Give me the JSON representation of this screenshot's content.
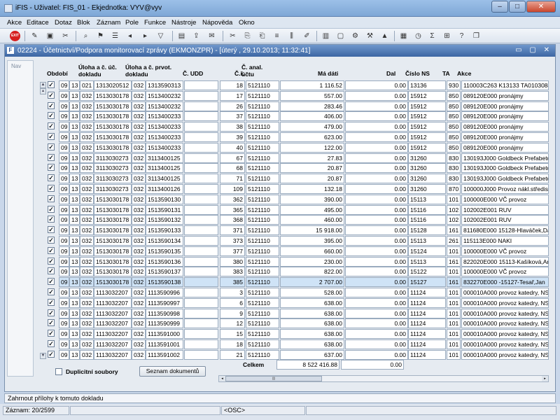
{
  "app": {
    "title": "iFIS - Uživatel: FIS_01 - Ekjednotka: VYV@vyv"
  },
  "window_buttons": {
    "minimize": "–",
    "maximize": "□",
    "close": "✕"
  },
  "menu": [
    {
      "label": "Akce"
    },
    {
      "label": "Editace"
    },
    {
      "label": "Dotaz"
    },
    {
      "label": "Blok"
    },
    {
      "label": "Záznam"
    },
    {
      "label": "Pole"
    },
    {
      "label": "Funkce"
    },
    {
      "label": "Nástroje"
    },
    {
      "label": "Nápověda"
    },
    {
      "label": "Okno"
    }
  ],
  "toolbar": {
    "exit_label": "EXIT"
  },
  "form": {
    "title": "02224 - Účetnictví/Podpora monitorovací zprávy (EKMONZPR) - [úterý , 29.10.2013; 11:32:41]",
    "window_buttons": "▭ ▢ ✕",
    "nav_label": "Nav"
  },
  "columns": {
    "obdobi": "Období",
    "uloha_dokladu": "Úloha a č. úč. dokladu",
    "uloha_prvot": "Úloha a č. prvot. dokladu",
    "c_udd": "Č. UDD",
    "c_r": "Č.ř.",
    "c_anal": "Č. anal. účtu",
    "ma_dati": "Má dáti",
    "dal": "Dal",
    "cislo_ns": "Číslo NS",
    "ta": "TA",
    "akce": "Akce"
  },
  "rows": [
    {
      "checked": true,
      "m": "09",
      "y": "13",
      "u1": "021",
      "d1": "1313020512",
      "u2": "032",
      "d2": "1313590313",
      "udd": "",
      "cr": "18",
      "anal": "5121110",
      "md": "1 116.52",
      "dal": "0.00",
      "ns": "13136",
      "ta": "930",
      "akce": "110003C263 K13133 TA01030847",
      "selected": false
    },
    {
      "checked": true,
      "m": "09",
      "y": "13",
      "u1": "032",
      "d1": "1513030178",
      "u2": "032",
      "d2": "1513400232",
      "udd": "",
      "cr": "17",
      "anal": "5121110",
      "md": "557.00",
      "dal": "0.00",
      "ns": "15912",
      "ta": "850",
      "akce": "089120E000 pronájmy",
      "selected": false
    },
    {
      "checked": true,
      "m": "09",
      "y": "13",
      "u1": "032",
      "d1": "1513030178",
      "u2": "032",
      "d2": "1513400232",
      "udd": "",
      "cr": "26",
      "anal": "5121110",
      "md": "283.46",
      "dal": "0.00",
      "ns": "15912",
      "ta": "850",
      "akce": "089120E000 pronájmy",
      "selected": false
    },
    {
      "checked": true,
      "m": "09",
      "y": "13",
      "u1": "032",
      "d1": "1513030178",
      "u2": "032",
      "d2": "1513400233",
      "udd": "",
      "cr": "37",
      "anal": "5121110",
      "md": "406.00",
      "dal": "0.00",
      "ns": "15912",
      "ta": "850",
      "akce": "089120E000 pronájmy",
      "selected": false
    },
    {
      "checked": true,
      "m": "09",
      "y": "13",
      "u1": "032",
      "d1": "1513030178",
      "u2": "032",
      "d2": "1513400233",
      "udd": "",
      "cr": "38",
      "anal": "5121110",
      "md": "479.00",
      "dal": "0.00",
      "ns": "15912",
      "ta": "850",
      "akce": "089120E000 pronájmy",
      "selected": false
    },
    {
      "checked": true,
      "m": "09",
      "y": "13",
      "u1": "032",
      "d1": "1513030178",
      "u2": "032",
      "d2": "1513400233",
      "udd": "",
      "cr": "39",
      "anal": "5121110",
      "md": "623.00",
      "dal": "0.00",
      "ns": "15912",
      "ta": "850",
      "akce": "089120E000 pronájmy",
      "selected": false
    },
    {
      "checked": true,
      "m": "09",
      "y": "13",
      "u1": "032",
      "d1": "1513030178",
      "u2": "032",
      "d2": "1513400233",
      "udd": "",
      "cr": "40",
      "anal": "5121110",
      "md": "122.00",
      "dal": "0.00",
      "ns": "15912",
      "ta": "850",
      "akce": "089120E000 pronájmy",
      "selected": false
    },
    {
      "checked": true,
      "m": "09",
      "y": "13",
      "u1": "032",
      "d1": "3113030273",
      "u2": "032",
      "d2": "3113400125",
      "udd": "",
      "cr": "67",
      "anal": "5121110",
      "md": "27.83",
      "dal": "0.00",
      "ns": "31260",
      "ta": "830",
      "akce": "130193J000 Goldbeck Prefabeton",
      "selected": false
    },
    {
      "checked": true,
      "m": "09",
      "y": "13",
      "u1": "032",
      "d1": "3113030273",
      "u2": "032",
      "d2": "3113400125",
      "udd": "",
      "cr": "68",
      "anal": "5121110",
      "md": "20.87",
      "dal": "0.00",
      "ns": "31260",
      "ta": "830",
      "akce": "130193J000 Goldbeck Prefabeton",
      "selected": false
    },
    {
      "checked": true,
      "m": "09",
      "y": "13",
      "u1": "032",
      "d1": "3113030273",
      "u2": "032",
      "d2": "3113400125",
      "udd": "",
      "cr": "71",
      "anal": "5121110",
      "md": "20.87",
      "dal": "0.00",
      "ns": "31260",
      "ta": "830",
      "akce": "130193J000 Goldbeck Prefabeton",
      "selected": false
    },
    {
      "checked": true,
      "m": "09",
      "y": "13",
      "u1": "032",
      "d1": "3113030273",
      "u2": "032",
      "d2": "3113400126",
      "udd": "",
      "cr": "109",
      "anal": "5121110",
      "md": "132.18",
      "dal": "0.00",
      "ns": "31260",
      "ta": "870",
      "akce": "100000J000 Provoz nákl.střediska",
      "selected": false
    },
    {
      "checked": true,
      "m": "09",
      "y": "13",
      "u1": "032",
      "d1": "1513030178",
      "u2": "032",
      "d2": "1513590130",
      "udd": "",
      "cr": "362",
      "anal": "5121110",
      "md": "390.00",
      "dal": "0.00",
      "ns": "15113",
      "ta": "101",
      "akce": "100000E000 VČ provoz",
      "selected": false
    },
    {
      "checked": true,
      "m": "09",
      "y": "13",
      "u1": "032",
      "d1": "1513030178",
      "u2": "032",
      "d2": "1513590131",
      "udd": "",
      "cr": "365",
      "anal": "5121110",
      "md": "495.00",
      "dal": "0.00",
      "ns": "15116",
      "ta": "102",
      "akce": "102002E001 RUV",
      "selected": false
    },
    {
      "checked": true,
      "m": "09",
      "y": "13",
      "u1": "032",
      "d1": "1513030178",
      "u2": "032",
      "d2": "1513590132",
      "udd": "",
      "cr": "368",
      "anal": "5121110",
      "md": "460.00",
      "dal": "0.00",
      "ns": "15116",
      "ta": "102",
      "akce": "102002E001 RUV",
      "selected": false
    },
    {
      "checked": true,
      "m": "09",
      "y": "13",
      "u1": "032",
      "d1": "1513030178",
      "u2": "032",
      "d2": "1513590133",
      "udd": "",
      "cr": "371",
      "anal": "5121110",
      "md": "15 918.00",
      "dal": "0.00",
      "ns": "15128",
      "ta": "161",
      "akce": "811680E000 15128-Hlaváček,Dalibo",
      "selected": false
    },
    {
      "checked": true,
      "m": "09",
      "y": "13",
      "u1": "032",
      "d1": "1513030178",
      "u2": "032",
      "d2": "1513590134",
      "udd": "",
      "cr": "373",
      "anal": "5121110",
      "md": "395.00",
      "dal": "0.00",
      "ns": "15113",
      "ta": "261",
      "akce": "115113E000 NAKI",
      "selected": false
    },
    {
      "checked": true,
      "m": "09",
      "y": "13",
      "u1": "032",
      "d1": "1513030178",
      "u2": "032",
      "d2": "1513590135",
      "udd": "",
      "cr": "377",
      "anal": "5121110",
      "md": "660.00",
      "dal": "0.00",
      "ns": "15124",
      "ta": "101",
      "akce": "100000E000 VČ provoz",
      "selected": false
    },
    {
      "checked": true,
      "m": "09",
      "y": "13",
      "u1": "032",
      "d1": "1513030178",
      "u2": "032",
      "d2": "1513590136",
      "udd": "",
      "cr": "380",
      "anal": "5121110",
      "md": "230.00",
      "dal": "0.00",
      "ns": "15113",
      "ta": "161",
      "akce": "822020E000 15113-Kašíková,Anna",
      "selected": false
    },
    {
      "checked": true,
      "m": "09",
      "y": "13",
      "u1": "032",
      "d1": "1513030178",
      "u2": "032",
      "d2": "1513590137",
      "udd": "",
      "cr": "383",
      "anal": "5121110",
      "md": "822.00",
      "dal": "0.00",
      "ns": "15122",
      "ta": "101",
      "akce": "100000E000 VČ provoz",
      "selected": false
    },
    {
      "checked": true,
      "m": "09",
      "y": "13",
      "u1": "032",
      "d1": "1513030178",
      "u2": "032",
      "d2": "1513590138",
      "udd": "",
      "cr": "385",
      "anal": "5121110",
      "md": "2 707.00",
      "dal": "0.00",
      "ns": "15127",
      "ta": "161",
      "akce": "832270E000 -15127-Tesař,Jan",
      "selected": true
    },
    {
      "checked": true,
      "m": "09",
      "y": "13",
      "u1": "032",
      "d1": "1113032207",
      "u2": "032",
      "d2": "1113590996",
      "udd": "",
      "cr": "3",
      "anal": "5121110",
      "md": "528.00",
      "dal": "0.00",
      "ns": "11124",
      "ta": "101",
      "akce": "000010A000 provoz katedry, NS",
      "selected": false
    },
    {
      "checked": true,
      "m": "09",
      "y": "13",
      "u1": "032",
      "d1": "1113032207",
      "u2": "032",
      "d2": "1113590997",
      "udd": "",
      "cr": "6",
      "anal": "5121110",
      "md": "638.00",
      "dal": "0.00",
      "ns": "11124",
      "ta": "101",
      "akce": "000010A000 provoz katedry, NS",
      "selected": false
    },
    {
      "checked": true,
      "m": "09",
      "y": "13",
      "u1": "032",
      "d1": "1113032207",
      "u2": "032",
      "d2": "1113590998",
      "udd": "",
      "cr": "9",
      "anal": "5121110",
      "md": "638.00",
      "dal": "0.00",
      "ns": "11124",
      "ta": "101",
      "akce": "000010A000 provoz katedry, NS",
      "selected": false
    },
    {
      "checked": true,
      "m": "09",
      "y": "13",
      "u1": "032",
      "d1": "1113032207",
      "u2": "032",
      "d2": "1113590999",
      "udd": "",
      "cr": "12",
      "anal": "5121110",
      "md": "638.00",
      "dal": "0.00",
      "ns": "11124",
      "ta": "101",
      "akce": "000010A000 provoz katedry, NS",
      "selected": false
    },
    {
      "checked": true,
      "m": "09",
      "y": "13",
      "u1": "032",
      "d1": "1113032207",
      "u2": "032",
      "d2": "1113591000",
      "udd": "",
      "cr": "15",
      "anal": "5121110",
      "md": "638.00",
      "dal": "0.00",
      "ns": "11124",
      "ta": "101",
      "akce": "000010A000 provoz katedry, NS",
      "selected": false
    },
    {
      "checked": true,
      "m": "09",
      "y": "13",
      "u1": "032",
      "d1": "1113032207",
      "u2": "032",
      "d2": "1113591001",
      "udd": "",
      "cr": "18",
      "anal": "5121110",
      "md": "638.00",
      "dal": "0.00",
      "ns": "11124",
      "ta": "101",
      "akce": "000010A000 provoz katedry, NS",
      "selected": false
    },
    {
      "checked": true,
      "m": "09",
      "y": "13",
      "u1": "032",
      "d1": "1113032207",
      "u2": "032",
      "d2": "1113591002",
      "udd": "",
      "cr": "21",
      "anal": "5121110",
      "md": "637.00",
      "dal": "0.00",
      "ns": "11124",
      "ta": "101",
      "akce": "000010A000 provoz katedry, NS",
      "selected": false
    }
  ],
  "totals": {
    "label": "Celkem",
    "ma_dati": "8 522 416.88",
    "dal": "0.00"
  },
  "footer": {
    "duplicitni_label": "Duplicitní soubory",
    "seznam_button": "Seznam dokumentů"
  },
  "status": {
    "message": "Zahrnout přílohy k tomuto dokladu",
    "record": "Záznam: 20/2599",
    "mode": "<OSC>"
  }
}
